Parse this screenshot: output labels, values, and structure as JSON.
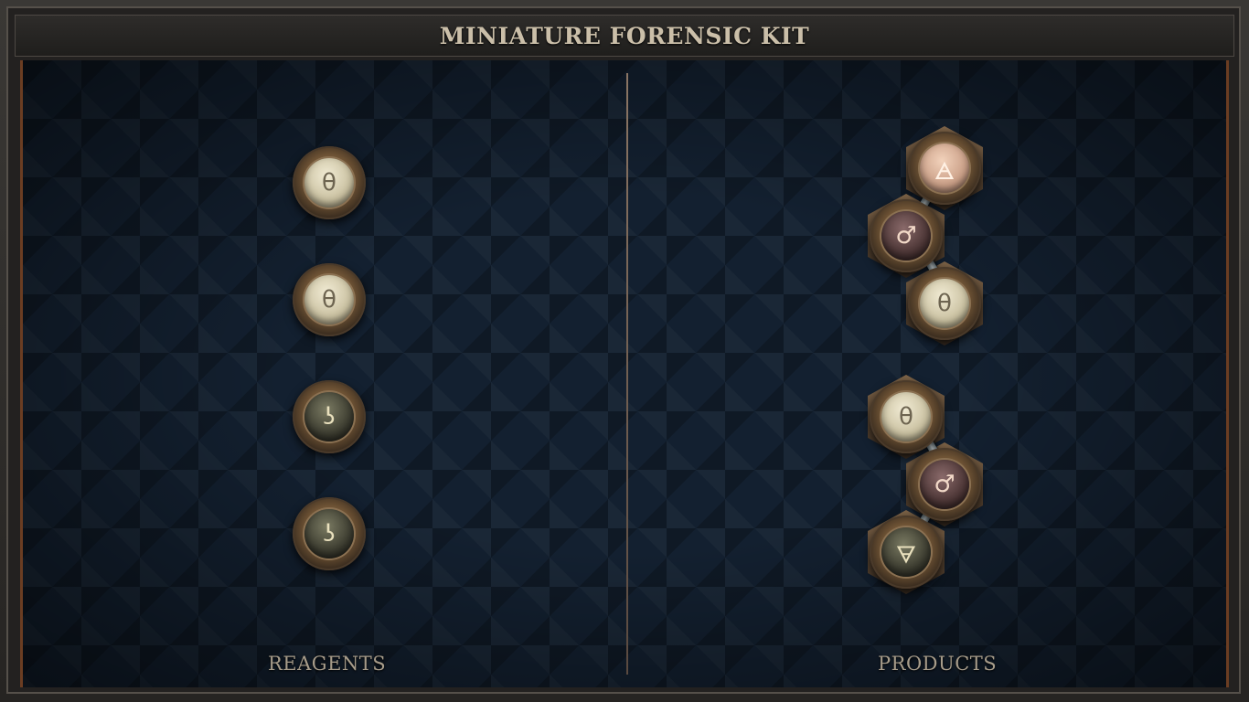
{
  "title": "MINIATURE FORENSIC KIT",
  "reagents": {
    "label": "REAGENTS",
    "items": [
      {
        "glyph": "θ",
        "kind": "cream"
      },
      {
        "glyph": "θ",
        "kind": "cream"
      },
      {
        "glyph": "ʖ",
        "kind": "dark"
      },
      {
        "glyph": "ʖ",
        "kind": "dark"
      }
    ]
  },
  "products": {
    "label": "PRODUCTS",
    "groups": [
      {
        "items": [
          {
            "glyph": "🜁",
            "kind": "rose"
          },
          {
            "glyph": "♂",
            "kind": "wine"
          },
          {
            "glyph": "θ",
            "kind": "cream"
          }
        ]
      },
      {
        "items": [
          {
            "glyph": "θ",
            "kind": "cream"
          },
          {
            "glyph": "♂",
            "kind": "wine"
          },
          {
            "glyph": "🜃",
            "kind": "dark"
          }
        ]
      }
    ]
  }
}
